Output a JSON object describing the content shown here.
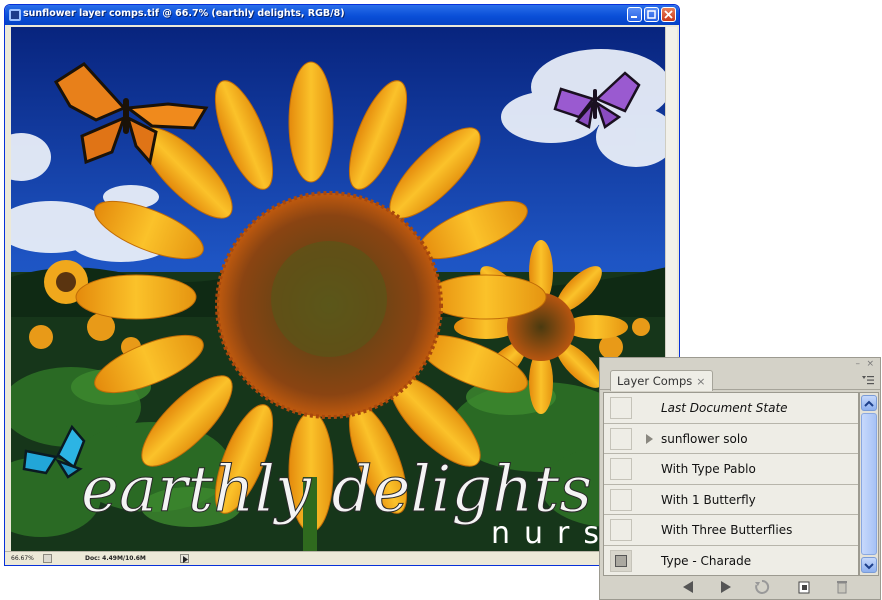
{
  "window": {
    "title": "sunflower layer comps.tif @ 66.7% (earthly delights, RGB/8)"
  },
  "status_bar": {
    "zoom": "66.67%",
    "doc_info": "Doc: 4.49M/10.6M"
  },
  "canvas": {
    "headline": "earthly delights",
    "subline": "nurse",
    "colors": {
      "sky": "#1a4fc2",
      "petal": "#f4b21c",
      "center": "#6a3a10",
      "foliage": "#1d4a1a"
    }
  },
  "layer_comps_panel": {
    "tab_label": "Layer Comps",
    "close_glyph": "×",
    "items": [
      {
        "label": "Last Document State",
        "italic": true,
        "applied": false,
        "expander": false
      },
      {
        "label": "sunflower solo",
        "italic": false,
        "applied": false,
        "expander": true
      },
      {
        "label": "With Type Pablo",
        "italic": false,
        "applied": false,
        "expander": false
      },
      {
        "label": "With 1 Butterfly",
        "italic": false,
        "applied": false,
        "expander": false
      },
      {
        "label": "With Three Butterflies",
        "italic": false,
        "applied": false,
        "expander": false
      },
      {
        "label": "Type - Charade",
        "italic": false,
        "applied": true,
        "expander": false
      }
    ],
    "footer_icons": [
      "previous-comp-icon",
      "next-comp-icon",
      "update-comp-icon",
      "new-comp-icon",
      "delete-comp-icon"
    ]
  }
}
